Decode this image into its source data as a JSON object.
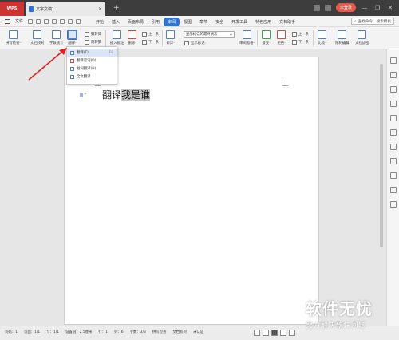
{
  "titlebar": {
    "app_label": "WPS",
    "doc_tab_label": "文字文稿1",
    "new_tab": "+",
    "right_items": [
      "",
      "",
      "",
      ""
    ],
    "login_label": "未登录",
    "window_controls": [
      "—",
      "❐",
      "✕"
    ]
  },
  "menubar": {
    "file_label": "文件",
    "tabs": [
      "开始",
      "插入",
      "页面布局",
      "引用",
      "审阅",
      "视图",
      "章节",
      "安全",
      "开发工具",
      "特色应用",
      "文档助手"
    ],
    "active_tab": "审阅",
    "search_placeholder": "查找命令、搜索模板"
  },
  "ribbon": {
    "buttons": [
      {
        "label": "拼写检查·"
      },
      {
        "label": "文档校对"
      },
      {
        "label": "字数统计"
      },
      {
        "label": "翻译·"
      },
      {
        "label": "插入批注"
      },
      {
        "label": "删除·"
      },
      {
        "label": "修订·"
      },
      {
        "label": "接受·"
      },
      {
        "label": "拒绝·"
      },
      {
        "label": "比较·"
      },
      {
        "label": "限制编辑"
      },
      {
        "label": "文档加密"
      }
    ],
    "small_items": [
      "繁转简",
      "简转繁",
      "上一条",
      "下一条",
      "显示标记·",
      "审阅窗格·",
      "上一条",
      "下一条"
    ],
    "markup_dropdown": "显示标记的最终状态"
  },
  "popup": {
    "items": [
      {
        "label": "翻译(T)",
        "shortcut": "F8"
      },
      {
        "label": "翻译否词(D)",
        "shortcut": ""
      },
      {
        "label": "划词翻译(H)",
        "shortcut": ""
      },
      {
        "label": "全文翻译",
        "shortcut": ""
      }
    ]
  },
  "document": {
    "text_plain": "翻译",
    "text_highlight": "我是谁"
  },
  "statusbar": {
    "items": [
      "页码：1",
      "页面：1/1",
      "节：1/1",
      "设置值：2.5厘米",
      "行：1",
      "列：6",
      "字数：3/3",
      "拼写检查",
      "文档校对",
      "未认证"
    ]
  },
  "watermark": {
    "main": "软件无忧",
    "sub": "努力解决软件问题"
  },
  "colors": {
    "accent": "#2e74d0",
    "wps_red": "#cc3333",
    "arrow": "#e02020"
  }
}
